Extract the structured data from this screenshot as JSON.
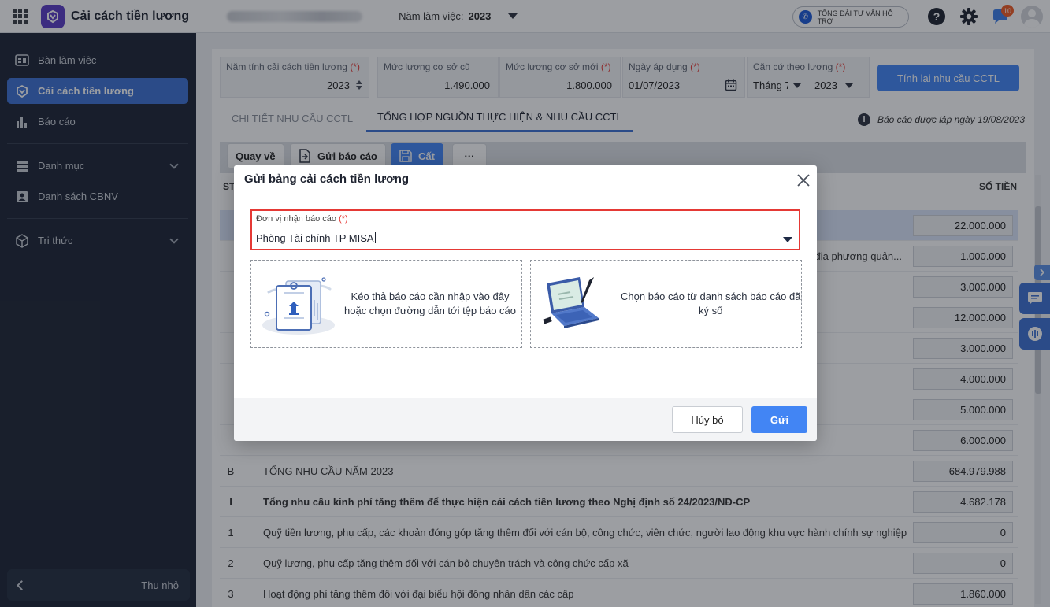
{
  "header": {
    "app_title": "Cải cách tiền lương",
    "year_label": "Năm làm việc:",
    "year_value": "2023",
    "hotline_label": "TỔNG ĐÀI TƯ VẤN HỖ TRỢ",
    "notification_count": "10"
  },
  "sidebar": {
    "items": [
      {
        "label": "Bàn làm việc",
        "icon": "dashboard-icon"
      },
      {
        "label": "Cải cách tiền lương",
        "icon": "app-logo-icon",
        "active": true
      },
      {
        "label": "Báo cáo",
        "icon": "chart-icon"
      },
      {
        "label": "Danh mục",
        "icon": "list-icon"
      },
      {
        "label": "Danh sách CBNV",
        "icon": "id-card-icon"
      },
      {
        "label": "Tri thức",
        "icon": "cube-icon"
      }
    ],
    "collapse_label": "Thu nhỏ"
  },
  "params": {
    "reform_year_label": "Năm tính cải cách tiền lương",
    "reform_year_value": "2023",
    "old_base_label": "Mức lương cơ sở cũ",
    "old_base_value": "1.490.000",
    "new_base_label": "Mức lương cơ sở mới",
    "new_base_value": "1.800.000",
    "apply_date_label": "Ngày áp dụng",
    "apply_date_value": "01/07/2023",
    "basis_label": "Căn cứ theo lương",
    "basis_month": "Tháng 7",
    "basis_year": "2023",
    "required_mark": "(*)",
    "recalc_button": "Tính lại nhu cầu CCTL"
  },
  "tabs": [
    {
      "label": "CHI TIẾT NHU CẦU CCTL",
      "active": false
    },
    {
      "label": "TỔNG HỢP NGUỒN THỰC HIỆN & NHU CẦU CCTL",
      "active": true
    }
  ],
  "report_date": "Báo cáo được lập ngày 19/08/2023",
  "toolbar": {
    "back": "Quay về",
    "send_report": "Gửi báo cáo",
    "save": "Cất",
    "more": "···"
  },
  "table": {
    "col_stt": "ST",
    "col_amount": "SỐ TIỀN",
    "rows": [
      {
        "stt": "",
        "desc": "",
        "amount": "22.000.000",
        "bold": false
      },
      {
        "stt": "",
        "desc": "địa phương quản...",
        "amount": "1.000.000",
        "bold": false
      },
      {
        "stt": "",
        "desc": "",
        "amount": "3.000.000",
        "bold": false
      },
      {
        "stt": "",
        "desc": "",
        "amount": "12.000.000",
        "bold": false
      },
      {
        "stt": "",
        "desc": "",
        "amount": "3.000.000",
        "bold": false
      },
      {
        "stt": "",
        "desc": "",
        "amount": "4.000.000",
        "bold": false
      },
      {
        "stt": "",
        "desc": "",
        "amount": "5.000.000",
        "bold": false
      },
      {
        "stt": "",
        "desc": "",
        "amount": "6.000.000",
        "bold": false
      },
      {
        "stt": "B",
        "desc": "TỔNG NHU CẦU NĂM 2023",
        "amount": "684.979.988",
        "bold": false
      },
      {
        "stt": "I",
        "desc": "Tổng nhu cầu kinh phí tăng thêm để thực hiện cải cách tiền lương theo Nghị định số 24/2023/NĐ-CP",
        "amount": "4.682.178",
        "bold": true
      },
      {
        "stt": "1",
        "desc": "Quỹ tiền lương, phụ cấp, các khoản đóng góp tăng thêm đối với cán bộ, công chức, viên chức, người lao động khu vực hành chính sự nghiệp",
        "amount": "0",
        "bold": false
      },
      {
        "stt": "2",
        "desc": "Quỹ lương, phụ cấp tăng thêm đối với cán bộ chuyên trách và công chức cấp xã",
        "amount": "0",
        "bold": false
      },
      {
        "stt": "3",
        "desc": "Hoạt động phí tăng thêm đối với đại biểu hội đồng nhân dân các cấp",
        "amount": "1.860.000",
        "bold": false
      }
    ]
  },
  "dialog": {
    "title": "Gửi bảng cải cách tiền lương",
    "field_label": "Đơn vị nhận báo cáo",
    "required_mark": "(*)",
    "field_value": "Phòng Tài chính TP MISA",
    "drop_upload_line1": "Kéo thả báo cáo cần nhập vào đây",
    "drop_upload_line2": "hoặc chọn đường dẫn tới tệp báo cáo",
    "drop_signed_line1": "Chọn báo cáo từ danh sách báo cáo đã",
    "drop_signed_line2": "ký số",
    "cancel_button": "Hủy bỏ",
    "send_button": "Gửi"
  },
  "colors": {
    "accent": "#4285f4",
    "sidebar_bg": "#1c2434",
    "active_nav": "#3d70d3",
    "required": "#e53935"
  }
}
